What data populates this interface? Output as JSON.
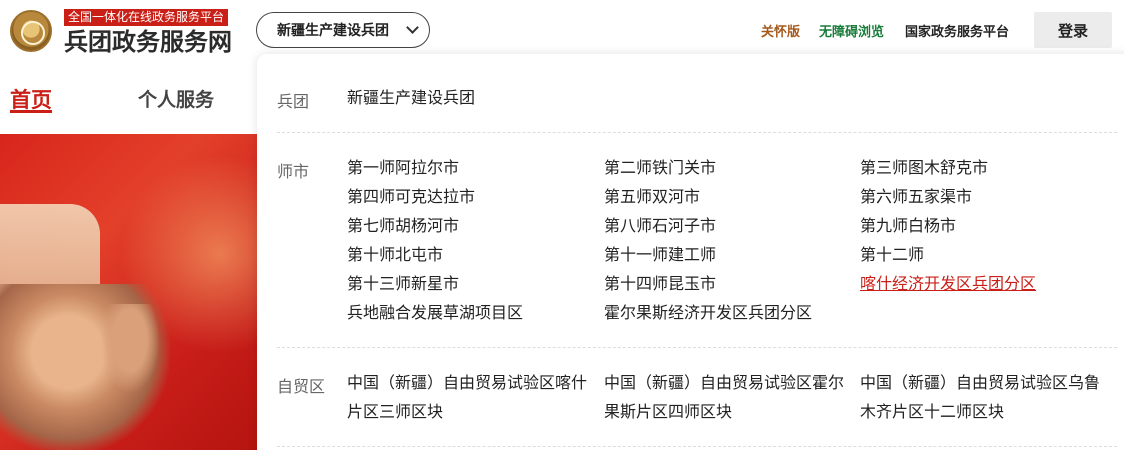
{
  "header": {
    "brand_tag": "全国一体化在线政务服务平台",
    "brand_name": "兵团政务服务网",
    "region_select": "新疆生产建设兵团",
    "links": {
      "care": "关怀版",
      "accessible": "无障碍浏览",
      "national": "国家政务服务平台"
    },
    "login": "登录",
    "colors": {
      "primary": "#c91f16",
      "care": "#a5591c",
      "accessible": "#1a7c3b"
    }
  },
  "nav": {
    "home": "首页",
    "personal": "个人服务"
  },
  "dropdown": {
    "bingtuan": {
      "label": "兵团",
      "items": [
        "新疆生产建设兵团"
      ]
    },
    "shishi": {
      "label": "师市",
      "items": [
        "第一师阿拉尔市",
        "第二师铁门关市",
        "第三师图木舒克市",
        "第四师可克达拉市",
        "第五师双河市",
        "第六师五家渠市",
        "第七师胡杨河市",
        "第八师石河子市",
        "第九师白杨市",
        "第十师北屯市",
        "第十一师建工师",
        "第十二师",
        "第十三师新星市",
        "第十四师昆玉市",
        "喀什经济开发区兵团分区",
        "兵地融合发展草湖项目区",
        "霍尔果斯经济开发区兵团分区"
      ]
    },
    "zimaoqu": {
      "label": "自贸区",
      "items": [
        "中国（新疆）自由贸易试验区喀什片区三师区块",
        "中国（新疆）自由贸易试验区霍尔果斯片区四师区块",
        "中国（新疆）自由贸易试验区乌鲁木齐片区十二师区块"
      ]
    }
  }
}
